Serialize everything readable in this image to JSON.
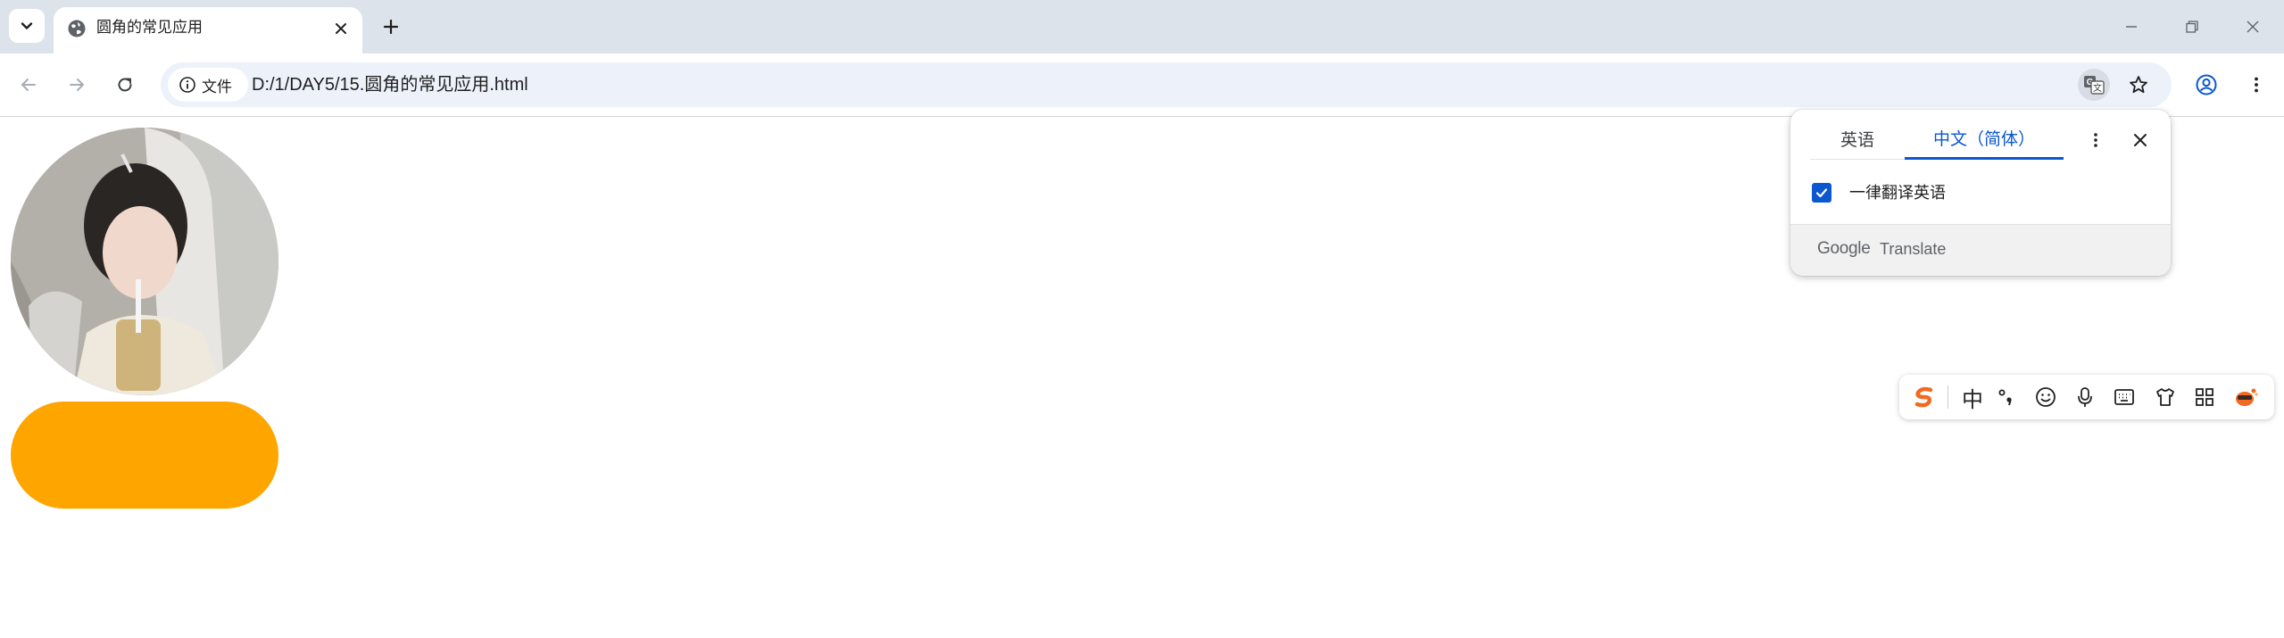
{
  "browser": {
    "tab": {
      "title": "圆角的常见应用",
      "favicon": "globe-icon"
    },
    "toolbar": {
      "site_chip_label": "文件",
      "url": "D:/1/DAY5/15.圆角的常见应用.html"
    }
  },
  "translate_popup": {
    "source_language": "英语",
    "target_language": "中文（简体）",
    "always_translate_label": "一律翻译英语",
    "always_translate_checked": true,
    "footer_brand": "Google",
    "footer_product": "Translate"
  },
  "page": {
    "avatar_image": "circular portrait photo",
    "pill_color": "#ffa500"
  },
  "ime_toolbar": {
    "mode_label": "中",
    "icons": [
      "sogou-logo-icon",
      "punctuation-icon",
      "emoji-icon",
      "microphone-icon",
      "keyboard-icon",
      "skin-shirt-icon",
      "toolbox-grid-icon",
      "mascot-icon"
    ]
  },
  "colors": {
    "accent_blue": "#0b57d0",
    "tabstrip_bg": "#dde3ea",
    "omnibox_bg": "#edf2fa",
    "orange_pill": "#ffa500"
  }
}
